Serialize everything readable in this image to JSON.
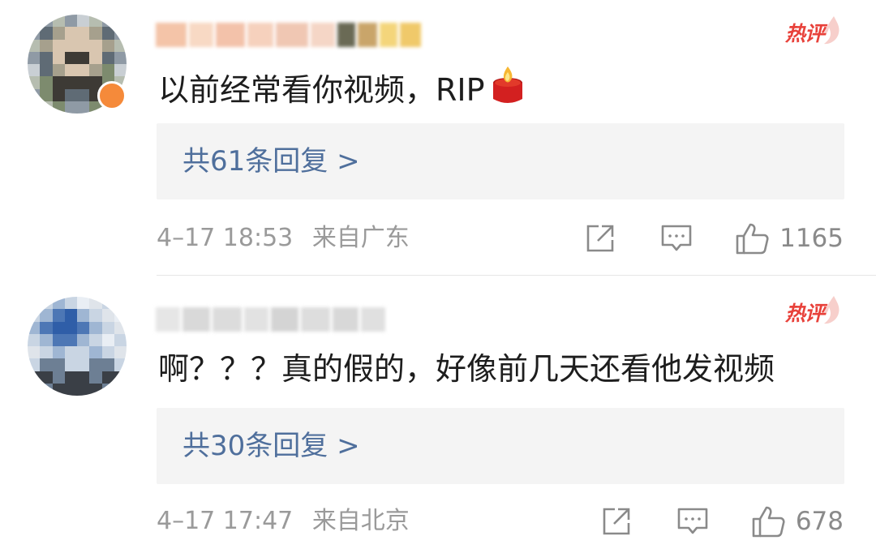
{
  "comments": [
    {
      "badge": "热评",
      "text": "以前经常看你视频，RIP",
      "text_icon": "candle-icon",
      "replies_label": "共61条回复 >",
      "date": "4–17 18:53",
      "location": "来自广东",
      "likes": "1165"
    },
    {
      "badge": "热评",
      "text": "啊？？？真的假的，好像前几天还看他发视频",
      "replies_label": "共30条回复 >",
      "date": "4–17 17:47",
      "location": "来自北京",
      "likes": "678"
    }
  ],
  "icons": {
    "share": "share-icon",
    "comment": "comment-icon",
    "like": "thumbs-up-icon",
    "hot_flame": "flame-icon"
  },
  "colors": {
    "reply_link": "#4f6f9c",
    "hot_badge": "#e8413a",
    "meta_text": "#9a9a9a",
    "reply_bg": "#f4f4f4"
  }
}
